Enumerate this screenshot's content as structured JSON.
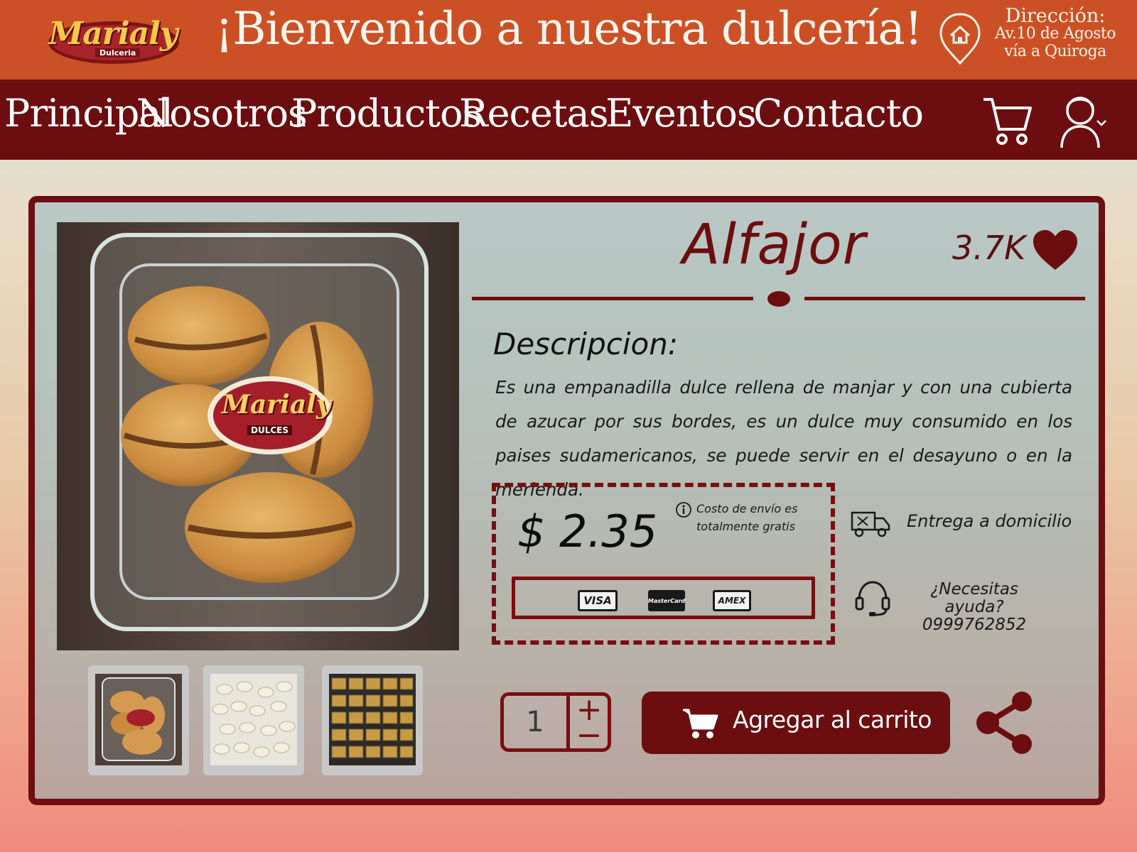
{
  "brand": {
    "logo_text": "Marialy",
    "logo_subtext": "Dulceria",
    "package_logo_text": "Marialy",
    "package_logo_subtext": "DULCES"
  },
  "header": {
    "welcome": "¡Bienvenido a nuestra dulcería!",
    "address_label": "Dirección:",
    "address_line1": "Av.10 de Agosto",
    "address_line2": "vía a Quiroga",
    "address_icon": "location-pin-home-icon"
  },
  "nav": {
    "items": [
      "Principal",
      "Nosotros",
      "Productos",
      "Recetas",
      "Eventos",
      "Contacto"
    ],
    "cart_icon": "shopping-cart-icon",
    "user_icon": "user-account-icon"
  },
  "product": {
    "name": "Alfajor",
    "likes": "3.7K",
    "description_heading": "Descripcion:",
    "description": "Es una empanadilla dulce rellena de manjar y con una cubierta de azucar por sus bordes, es un dulce muy consumido en los paises sudamericanos, se puede servir en el desayuno o en la merienda.",
    "price": "$ 2.35",
    "shipping_note": "Costo de envío es totalmente gratis",
    "payment_methods": [
      "VISA",
      "MasterCard",
      "AMEX"
    ],
    "delivery": "Entrega a domicilio",
    "help_question": "¿Necesitas ayuda?",
    "help_phone": "0999762852",
    "quantity": "1",
    "qty_plus": "+",
    "qty_minus": "−",
    "add_to_cart": "Agregar al carrito"
  },
  "colors": {
    "header_orange": "#cc5025",
    "nav_maroon": "#6c0d0f",
    "accent": "#7a0d10"
  }
}
